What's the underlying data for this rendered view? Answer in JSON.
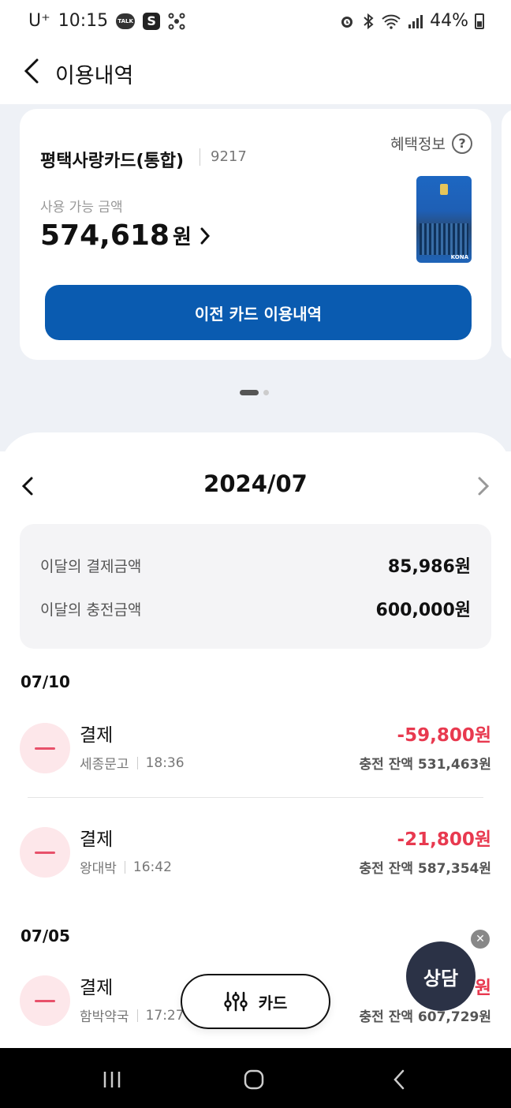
{
  "status_bar": {
    "carrier": "U⁺",
    "time": "10:15",
    "talk_badge": "TALK",
    "s_badge": "S",
    "battery": "44%"
  },
  "header": {
    "title": "이용내역"
  },
  "card": {
    "name": "평택사랑카드(통합)",
    "number": "9217",
    "benefit_label": "혜택정보",
    "help_glyph": "?",
    "available_label": "사용 가능 금액",
    "available_amount": "574,618",
    "available_unit": "원",
    "thumb_brand": "KONA",
    "prev_button": "이전 카드 이용내역"
  },
  "month": {
    "label": "2024/07"
  },
  "summary": {
    "payment_label": "이달의 결제금액",
    "payment_value": "85,986원",
    "charge_label": "이달의 충전금액",
    "charge_value": "600,000원"
  },
  "groups": [
    {
      "date": "07/10",
      "transactions": [
        {
          "type": "결제",
          "merchant": "세종문고",
          "time": "18:36",
          "amount": "-59,800원",
          "balance": "충전 잔액 531,463원"
        },
        {
          "type": "결제",
          "merchant": "왕대박",
          "time": "16:42",
          "amount": "-21,800원",
          "balance": "충전 잔액 587,354원"
        }
      ]
    },
    {
      "date": "07/05",
      "transactions": [
        {
          "type": "결제",
          "merchant": "함박약국",
          "time": "17:27",
          "amount": "원",
          "balance": "충전 잔액 607,729원"
        }
      ]
    }
  ],
  "floating": {
    "card_filter_label": "카드",
    "consult_label": "상담",
    "close_glyph": "✕"
  },
  "colors": {
    "primary": "#0a5bb0",
    "negative": "#e8394f",
    "background": "#eef1f6"
  }
}
